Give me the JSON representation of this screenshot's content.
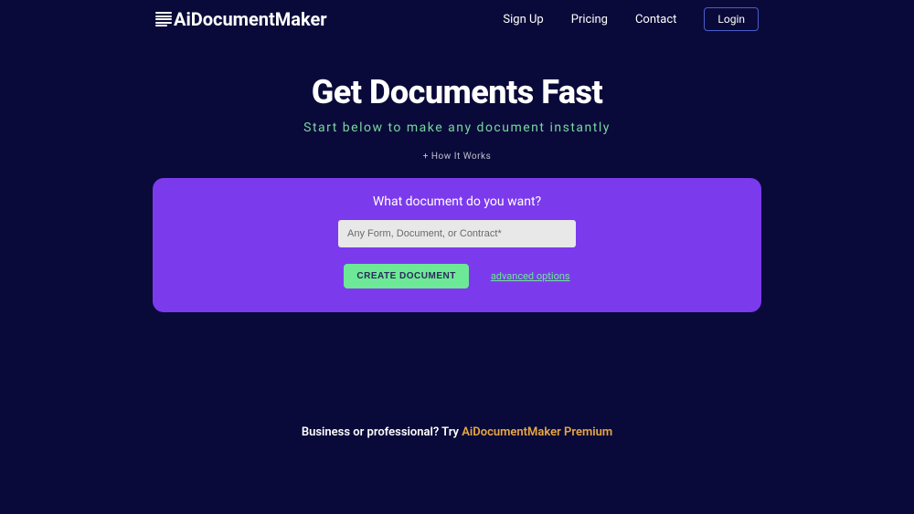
{
  "header": {
    "logo_text": "AiDocumentMaker",
    "nav": {
      "signup": "Sign Up",
      "pricing": "Pricing",
      "contact": "Contact",
      "login": "Login"
    }
  },
  "main": {
    "title": "Get Documents Fast",
    "subtitle": "Start below to make any document instantly",
    "how_it_works": "+ How It Works"
  },
  "form": {
    "label": "What document do you want?",
    "input_placeholder": "Any Form, Document, or Contract*",
    "create_button": "CREATE DOCUMENT",
    "advanced_link": "advanced options"
  },
  "footer": {
    "text_prefix": "Business or professional? Try ",
    "text_link": "AiDocumentMaker Premium"
  }
}
